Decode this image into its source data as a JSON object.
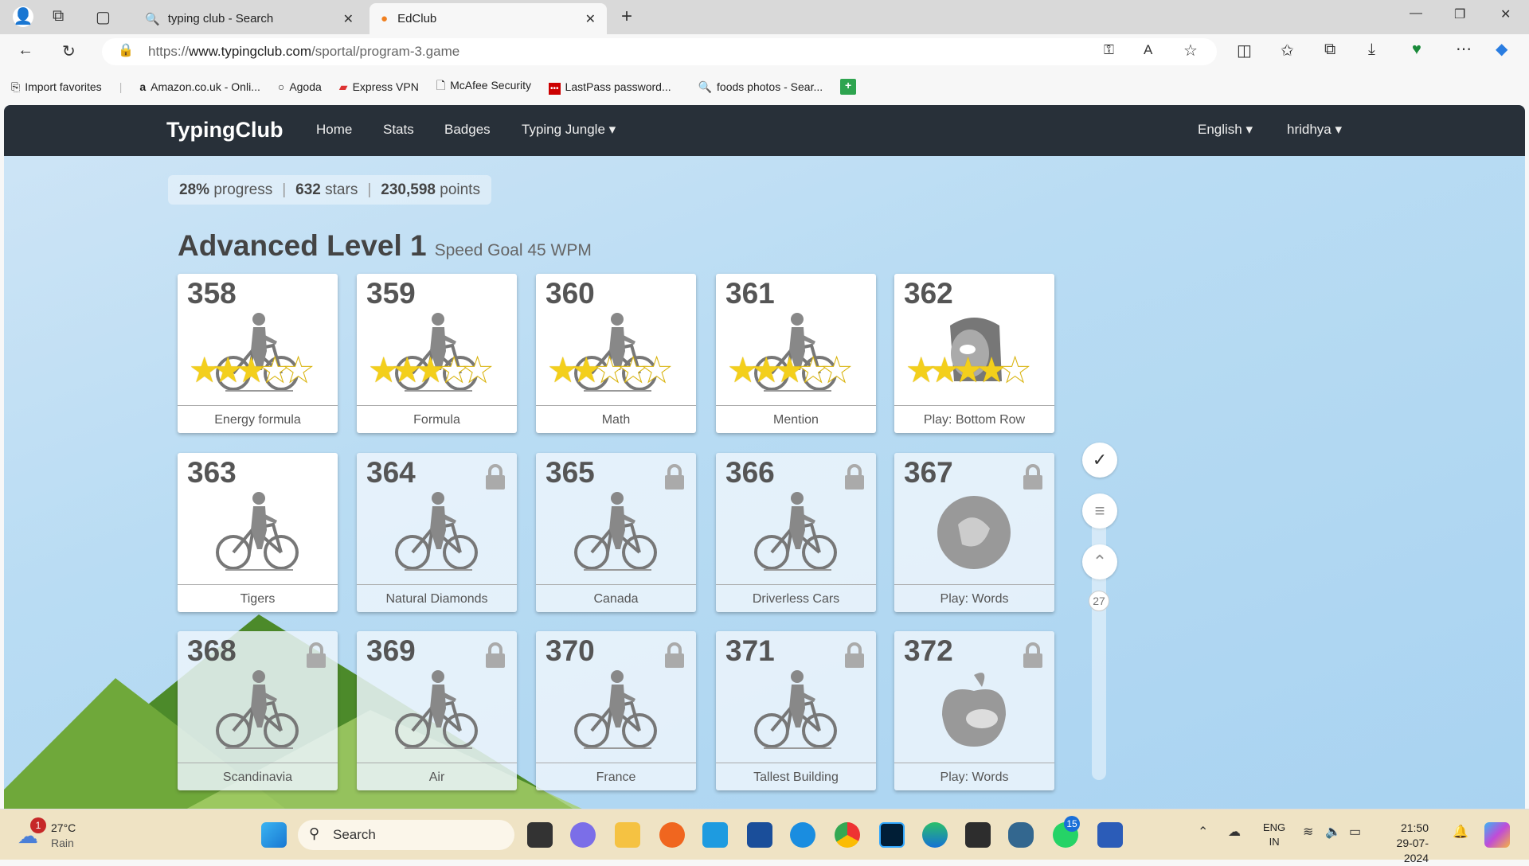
{
  "browser": {
    "tabs": [
      {
        "label": "typing club - Search"
      },
      {
        "label": "EdClub"
      }
    ],
    "url_prefix": "https://",
    "url_domain": "www.typingclub.com",
    "url_path": "/sportal/program-3.game",
    "bookmarks": [
      "Import favorites",
      "Amazon.co.uk - Onli...",
      "Agoda",
      "Express VPN",
      "McAfee Security",
      "LastPass password...",
      "foods photos - Sear..."
    ]
  },
  "nav": {
    "logo": "TypingClub",
    "items": [
      "Home",
      "Stats",
      "Badges",
      "Typing Jungle ▾"
    ],
    "language": "English ▾",
    "user": "hridhya ▾"
  },
  "stats": {
    "progress": "28%",
    "progress_label": "progress",
    "stars": "632",
    "stars_label": "stars",
    "points": "230,598",
    "points_label": "points"
  },
  "level": {
    "title": "Advanced Level 1",
    "subtitle": "Speed Goal 45 WPM"
  },
  "lessons": [
    {
      "num": "358",
      "label": "Energy formula",
      "stars": 3,
      "locked": false,
      "art": "bike"
    },
    {
      "num": "359",
      "label": "Formula",
      "stars": 3,
      "locked": false,
      "art": "bike"
    },
    {
      "num": "360",
      "label": "Math",
      "stars": 2,
      "locked": false,
      "art": "bike"
    },
    {
      "num": "361",
      "label": "Mention",
      "stars": 3,
      "locked": false,
      "art": "bike"
    },
    {
      "num": "362",
      "label": "Play: Bottom Row",
      "stars": 4,
      "locked": false,
      "art": "monster"
    },
    {
      "num": "363",
      "label": "Tigers",
      "stars": null,
      "locked": false,
      "art": "bike"
    },
    {
      "num": "364",
      "label": "Natural Diamonds",
      "stars": null,
      "locked": true,
      "art": "bike"
    },
    {
      "num": "365",
      "label": "Canada",
      "stars": null,
      "locked": true,
      "art": "bike"
    },
    {
      "num": "366",
      "label": "Driverless Cars",
      "stars": null,
      "locked": true,
      "art": "bike"
    },
    {
      "num": "367",
      "label": "Play: Words",
      "stars": null,
      "locked": true,
      "art": "game"
    },
    {
      "num": "368",
      "label": "Scandinavia",
      "stars": null,
      "locked": true,
      "art": "bike"
    },
    {
      "num": "369",
      "label": "Air",
      "stars": null,
      "locked": true,
      "art": "bike"
    },
    {
      "num": "370",
      "label": "France",
      "stars": null,
      "locked": true,
      "art": "bike"
    },
    {
      "num": "371",
      "label": "Tallest Building",
      "stars": null,
      "locked": true,
      "art": "bike"
    },
    {
      "num": "372",
      "label": "Play: Words",
      "stars": null,
      "locked": true,
      "art": "apple"
    }
  ],
  "scroller": {
    "page": "27"
  },
  "taskbar": {
    "weather_temp": "27°C",
    "weather_desc": "Rain",
    "weather_badge": "1",
    "search": "Search",
    "whatsapp_badge": "15",
    "lang1": "ENG",
    "lang2": "IN",
    "time": "21:50",
    "date": "29-07-2024"
  }
}
